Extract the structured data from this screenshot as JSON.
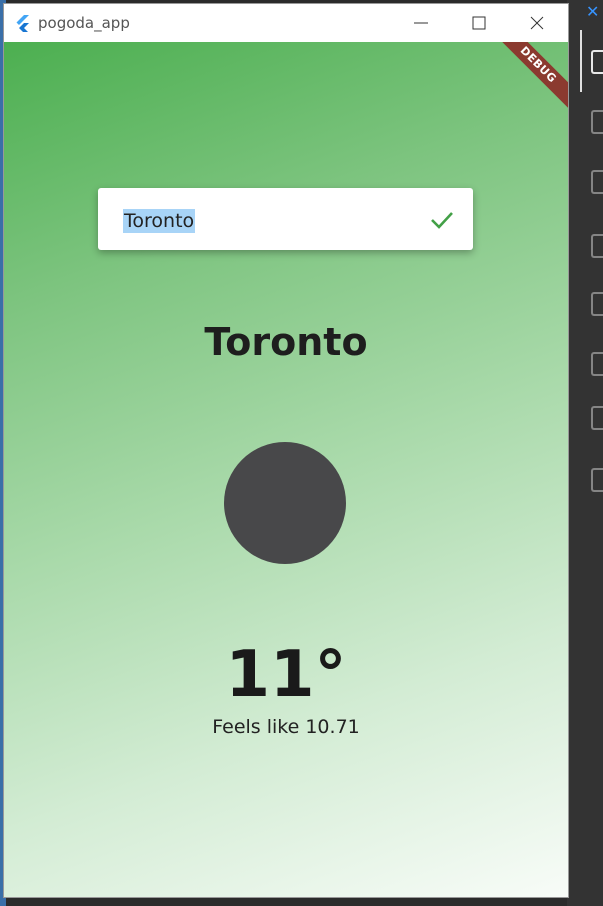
{
  "window": {
    "title": "pogoda_app",
    "debug_banner": "DEBUG"
  },
  "search": {
    "value": "Toronto"
  },
  "weather": {
    "city": "Toronto",
    "temperature": "11°",
    "feels_like": "Feels like 10.71"
  },
  "colors": {
    "gradient_start": "#4caf50",
    "gradient_end": "#f8fcf8",
    "check": "#43a047",
    "icon_placeholder": "#48484a",
    "selection": "#a8d4f7"
  },
  "icons": {
    "app": "flutter-logo-icon",
    "minimize": "minimize-icon",
    "maximize": "maximize-icon",
    "close": "close-icon",
    "submit": "check-icon",
    "weather": "weather-icon"
  }
}
